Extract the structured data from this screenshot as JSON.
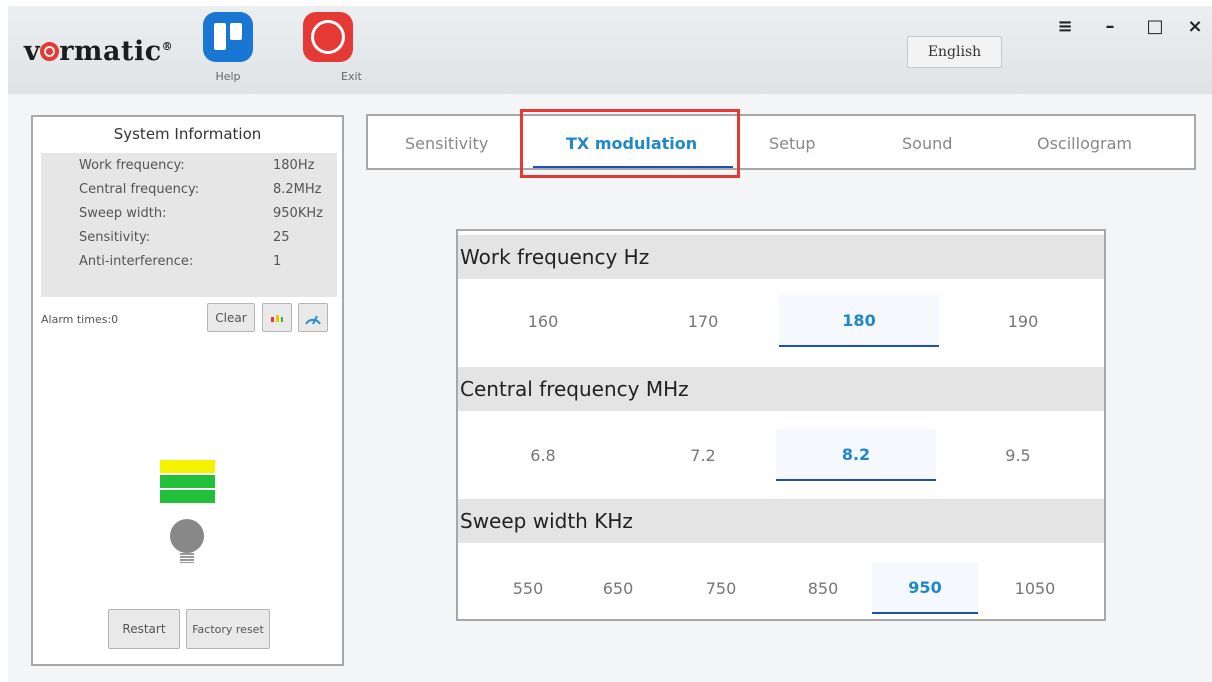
{
  "header": {
    "logo": "vormatic",
    "help_label": "Help",
    "exit_label": "Exit",
    "language": "English",
    "window_controls": {
      "menu": "≡",
      "minimize": "–",
      "maximize": "□",
      "close": "×"
    }
  },
  "system_info": {
    "title": "System Information",
    "rows": [
      {
        "label": "Work frequency:",
        "value": "180Hz"
      },
      {
        "label": "Central frequency:",
        "value": "8.2MHz"
      },
      {
        "label": "Sweep width:",
        "value": "950KHz"
      },
      {
        "label": "Sensitivity:",
        "value": "25"
      },
      {
        "label": "Anti-interference:",
        "value": "1"
      }
    ],
    "alarm_times": "Alarm times:0",
    "clear_label": "Clear",
    "restart_label": "Restart",
    "factory_reset_label": "Factory reset"
  },
  "tabs": [
    "Sensitivity",
    "TX modulation",
    "Setup",
    "Sound",
    "Oscillogram"
  ],
  "active_tab": "TX modulation",
  "settings": {
    "work_frequency": {
      "title": "Work frequency  Hz",
      "options": [
        "160",
        "170",
        "180",
        "190"
      ],
      "selected": "180"
    },
    "central_frequency": {
      "title": "Central frequency  MHz",
      "options": [
        "6.8",
        "7.2",
        "8.2",
        "9.5"
      ],
      "selected": "8.2"
    },
    "sweep_width": {
      "title": "Sweep width  KHz",
      "options": [
        "550",
        "650",
        "750",
        "850",
        "950",
        "1050"
      ],
      "selected": "950"
    }
  },
  "colors": {
    "accent": "#1e88c8",
    "underline": "#1e4fb5",
    "highlight_box": "#e53935",
    "bar_yellow": "#f5f200",
    "bar_green": "#22c03a"
  }
}
